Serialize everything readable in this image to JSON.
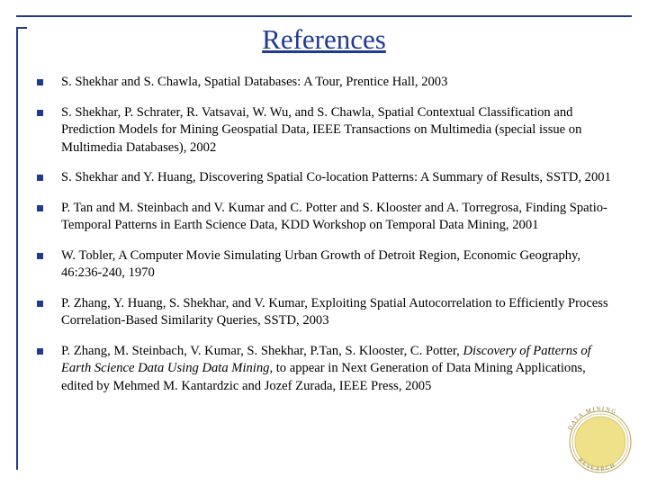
{
  "slide": {
    "title": "References",
    "references": [
      {
        "id": "ref-1",
        "parts": [
          {
            "text": "S. Shekhar and S. Chawla, Spatial Databases: A Tour, Prentice Hall, 2003",
            "italic": false
          }
        ]
      },
      {
        "id": "ref-2",
        "parts": [
          {
            "text": "S. Shekhar, P. Schrater, R. Vatsavai, W. Wu, and S. Chawla, Spatial Contextual Classification and Prediction Models for Mining Geospatial Data, IEEE Transactions on Multimedia (special issue on Multimedia Databases), 2002",
            "italic": false
          }
        ]
      },
      {
        "id": "ref-3",
        "parts": [
          {
            "text": "S. Shekhar and Y. Huang, Discovering Spatial Co-location Patterns: A Summary of Results, SSTD, 2001",
            "italic": false
          }
        ]
      },
      {
        "id": "ref-4",
        "parts": [
          {
            "text": "P. Tan and M. Steinbach and V. Kumar and C. Potter and S. Klooster and A. Torregrosa, Finding Spatio-Temporal Patterns in Earth Science Data, KDD Workshop on Temporal Data Mining, 2001",
            "italic": false
          }
        ]
      },
      {
        "id": "ref-5",
        "parts": [
          {
            "text": "W. Tobler, A Computer Movie Simulating Urban Growth of Detroit Region, Economic Geography, 46:236-240, 1970",
            "italic": false
          }
        ]
      },
      {
        "id": "ref-6",
        "parts": [
          {
            "text": "P. Zhang, Y. Huang, S. Shekhar, and V. Kumar, Exploiting Spatial Autocorrelation to Efficiently Process Correlation-Based Similarity Queries, SSTD, 2003",
            "italic": false
          }
        ]
      },
      {
        "id": "ref-7",
        "parts": [
          {
            "text": "P. Zhang, M. Steinbach, V. Kumar, S. Shekhar, P.Tan, S. Klooster, C. Potter, ",
            "italic": false
          },
          {
            "text": "Discovery of Patterns of Earth Science Data Using Data Mining",
            "italic": true
          },
          {
            "text": ", to appear in Next Generation of Data Mining Applications, edited by Mehmed M. Kantardzic and Jozef Zurada, IEEE Press, 2005",
            "italic": false
          }
        ]
      }
    ],
    "seal": {
      "name": "research-seal-logo",
      "text_top": "DATA MINING RESEARCH",
      "color": "#efe08a",
      "outline": "#b8a14a"
    },
    "colors": {
      "accent": "#1f3a93",
      "text": "#000000",
      "background": "#ffffff"
    }
  }
}
